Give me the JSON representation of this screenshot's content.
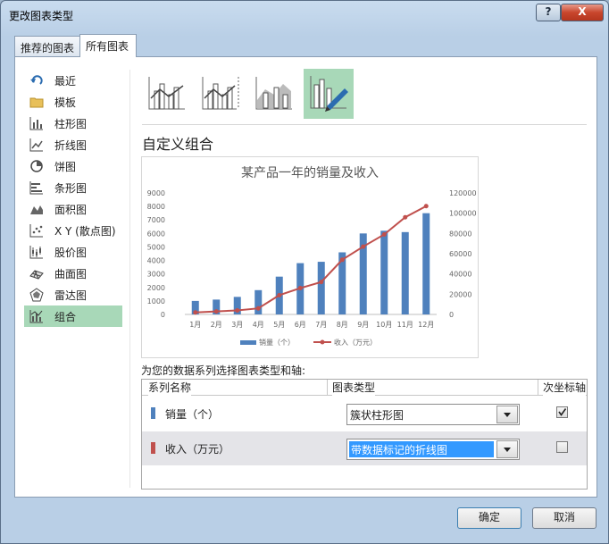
{
  "window": {
    "title": "更改图表类型",
    "help_label": "?",
    "close_label": "X"
  },
  "tabs": [
    {
      "label": "推荐的图表"
    },
    {
      "label": "所有图表"
    }
  ],
  "sidebar": {
    "items": [
      {
        "label": "最近",
        "icon": "recent-arrow-icon"
      },
      {
        "label": "模板",
        "icon": "folder-icon"
      },
      {
        "label": "柱形图",
        "icon": "column-chart-icon"
      },
      {
        "label": "折线图",
        "icon": "line-chart-icon"
      },
      {
        "label": "饼图",
        "icon": "pie-chart-icon"
      },
      {
        "label": "条形图",
        "icon": "bar-chart-icon"
      },
      {
        "label": "面积图",
        "icon": "area-chart-icon"
      },
      {
        "label": "X Y (散点图)",
        "icon": "scatter-chart-icon"
      },
      {
        "label": "股价图",
        "icon": "stock-chart-icon"
      },
      {
        "label": "曲面图",
        "icon": "surface-chart-icon"
      },
      {
        "label": "雷达图",
        "icon": "radar-chart-icon"
      },
      {
        "label": "组合",
        "icon": "combo-chart-icon"
      }
    ],
    "selected_index": 11
  },
  "subtypes": [
    "clustered-column-line-icon",
    "clustered-column-line-secondary-icon",
    "stacked-area-column-icon",
    "custom-combo-icon"
  ],
  "section_title": "自定义组合",
  "chart_data": {
    "type": "bar",
    "title": "某产品一年的销量及收入",
    "categories": [
      "1月",
      "2月",
      "3月",
      "4月",
      "5月",
      "6月",
      "7月",
      "8月",
      "9月",
      "10月",
      "11月",
      "12月"
    ],
    "series": [
      {
        "name": "销量（个）",
        "type": "bar",
        "axis": "primary",
        "color": "#4f81bd",
        "values": [
          1000,
          1100,
          1300,
          1800,
          2800,
          3800,
          3900,
          4600,
          6000,
          6200,
          6100,
          7500
        ]
      },
      {
        "name": "收入（万元）",
        "type": "line",
        "axis": "secondary",
        "color": "#c0504d",
        "values": [
          2000,
          3000,
          4000,
          6000,
          19000,
          26000,
          32000,
          54000,
          67000,
          79000,
          96000,
          107000
        ]
      }
    ],
    "ylim": [
      0,
      9000
    ],
    "yticks": [
      "0",
      "1000",
      "2000",
      "3000",
      "4000",
      "5000",
      "6000",
      "7000",
      "8000",
      "9000"
    ],
    "y2lim": [
      0,
      120000
    ],
    "y2ticks": [
      "0",
      "20000",
      "40000",
      "60000",
      "80000",
      "100000",
      "120000"
    ],
    "legend": "bottom",
    "grid": false
  },
  "axis_prompt": "为您的数据系列选择图表类型和轴:",
  "series_grid": {
    "headers": {
      "name": "系列名称",
      "type": "图表类型",
      "secondary": "次坐标轴"
    },
    "rows": [
      {
        "name": "销量（个）",
        "color": "#4f81bd",
        "chart_type": "簇状柱形图",
        "secondary_axis": true
      },
      {
        "name": "收入（万元）",
        "color": "#c0504d",
        "chart_type": "带数据标记的折线图",
        "secondary_axis": false
      }
    ]
  },
  "buttons": {
    "ok": "确定",
    "cancel": "取消"
  }
}
